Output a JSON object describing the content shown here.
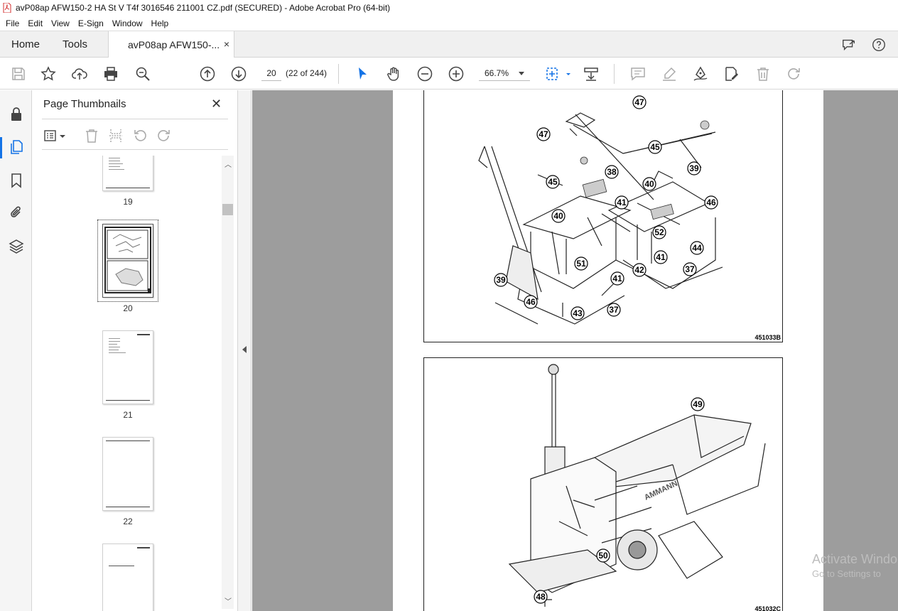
{
  "window": {
    "title": "avP08ap AFW150-2 HA St V T4f 3016546 211001 CZ.pdf (SECURED) - Adobe Acrobat Pro (64-bit)",
    "pdf_icon": "pdf-file-icon"
  },
  "menu": {
    "items": [
      "File",
      "Edit",
      "View",
      "E-Sign",
      "Window",
      "Help"
    ]
  },
  "tabs": {
    "home": "Home",
    "tools": "Tools",
    "document": "avP08ap AFW150-...",
    "close": "×"
  },
  "toolbar": {
    "page_number": "20",
    "page_count": "(22 of 244)",
    "zoom": "66.7%"
  },
  "thumbnails_panel": {
    "title": "Page Thumbnails",
    "close": "✕",
    "pages": [
      "19",
      "20",
      "21",
      "22"
    ],
    "selected_page": "20"
  },
  "document": {
    "figure1": {
      "code": "451033B",
      "callouts": [
        "47",
        "47",
        "45",
        "45",
        "38",
        "40",
        "39",
        "46",
        "41",
        "40",
        "52",
        "51",
        "44",
        "41",
        "42",
        "37",
        "39",
        "41",
        "46",
        "43",
        "37"
      ]
    },
    "figure2": {
      "code": "451032C",
      "callouts": [
        "49",
        "50",
        "48"
      ]
    }
  },
  "watermark": {
    "line1": "Activate Windo",
    "line2": "Go to Settings to"
  }
}
